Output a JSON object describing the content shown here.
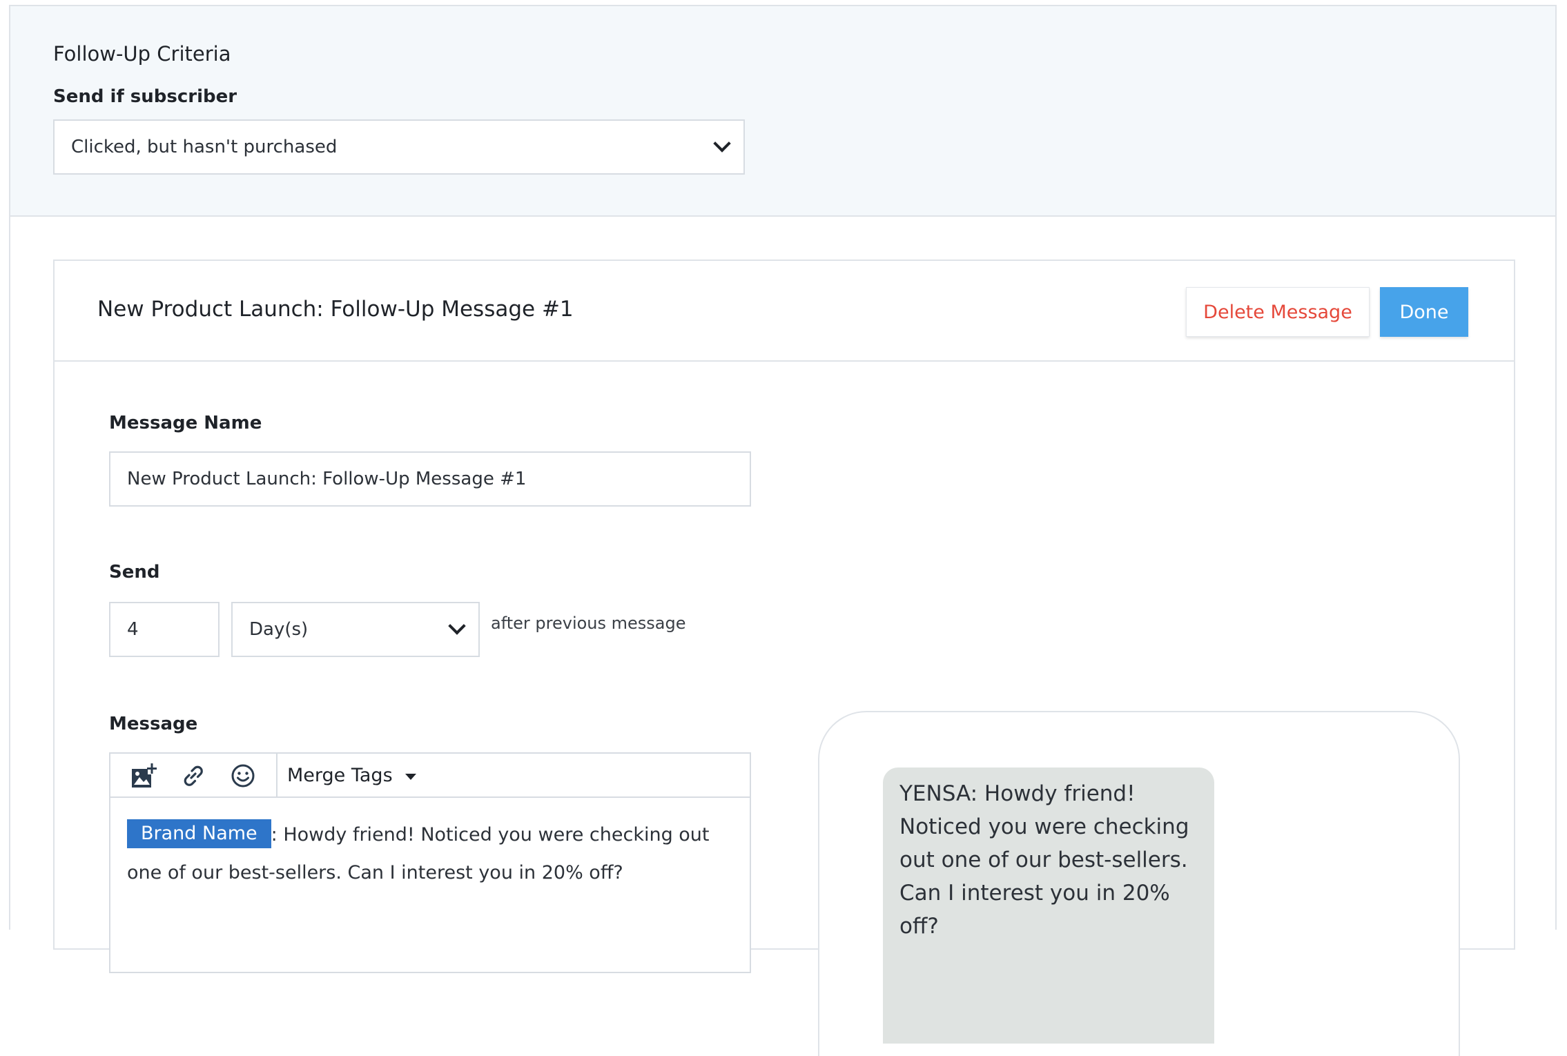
{
  "criteria": {
    "title": "Follow-Up Criteria",
    "label": "Send if subscriber",
    "selected": "Clicked, but hasn't purchased"
  },
  "message_card": {
    "title": "New Product Launch: Follow-Up Message #1",
    "delete_label": "Delete Message",
    "done_label": "Done"
  },
  "form": {
    "name_label": "Message Name",
    "name_value": "New Product Launch: Follow-Up Message #1",
    "send_label": "Send",
    "send_number": "4",
    "send_unit": "Day(s)",
    "send_after": "after previous message",
    "message_label": "Message"
  },
  "editor": {
    "toolbar": {
      "merge_tags_label": "Merge Tags",
      "icons": [
        "add-image-icon",
        "link-icon",
        "emoji-icon",
        "caret-down-icon"
      ]
    },
    "merge_chip": "Brand Name",
    "body_text": ": Howdy friend! Noticed you were checking out one of our best-sellers. Can I interest you in 20% off?"
  },
  "preview": {
    "bubble_text": "YENSA: Howdy friend! Noticed you were checking out one of our best-sellers. Can I interest you in 20% off?"
  },
  "colors": {
    "criteria_bg": "#f4f8fb",
    "border": "#dfe3e8",
    "delete_text": "#e5483a",
    "done_bg": "#47a3ea",
    "merge_chip_bg": "#2e75c9",
    "bubble_bg": "#dfe3e1"
  }
}
